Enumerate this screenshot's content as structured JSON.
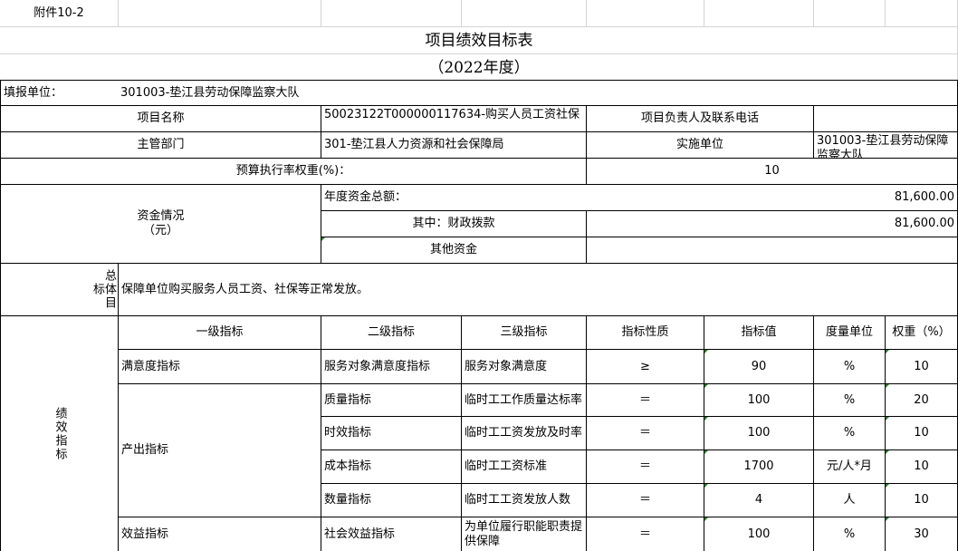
{
  "attachment": "附件10-2",
  "title": "项目绩效目标表",
  "year": "（2022年度）",
  "unit_label": "填报单位：",
  "unit_value": "301003-垫江县劳动保障监察大队",
  "project_name_label": "项目名称",
  "project_name_value": "50023122T000000117634-购买人员工资社保",
  "contact_label": "项目负责人及联系电话",
  "contact_value": "",
  "dept_label": "主管部门",
  "dept_value": "301-垫江县人力资源和社会保障局",
  "impl_label": "实施单位",
  "impl_value": "301003-垫江县劳动保障监察大队",
  "budget_weight_label": "预算执行率权重(%)：",
  "budget_weight_value": "10",
  "funds_label": "资金情况\n（元）",
  "funds_total_label": "年度资金总额：",
  "funds_total_value": "81,600.00",
  "funds_fiscal_label": "其中：财政拨款",
  "funds_fiscal_value": "81,600.00",
  "funds_other_label": "其他资金",
  "funds_other_value": "",
  "goal_label": "总体目标",
  "goal_value": "保障单位购买服务人员工资、社保等正常发放。",
  "perf_label": "绩效指标",
  "headers": [
    "一级指标",
    "二级指标",
    "三级指标",
    "指标性质",
    "指标值",
    "度量单位",
    "权重（%）"
  ],
  "level1": [
    "满意度指标",
    "产出指标",
    "效益指标"
  ],
  "rows": [
    {
      "l2": "服务对象满意度指标",
      "l3": "服务对象满意度",
      "nature": "≥",
      "value": "90",
      "unit": "%",
      "weight": "10"
    },
    {
      "l2": "质量指标",
      "l3": "临时工工作质量达标率",
      "nature": "＝",
      "value": "100",
      "unit": "%",
      "weight": "20"
    },
    {
      "l2": "时效指标",
      "l3": "临时工工资发放及时率",
      "nature": "＝",
      "value": "100",
      "unit": "%",
      "weight": "10"
    },
    {
      "l2": "成本指标",
      "l3": "临时工工资标准",
      "nature": "＝",
      "value": "1700",
      "unit": "元/人*月",
      "weight": "10"
    },
    {
      "l2": "数量指标",
      "l3": "临时工工资发放人数",
      "nature": "＝",
      "value": "4",
      "unit": "人",
      "weight": "10"
    },
    {
      "l2": "社会效益指标",
      "l3": "为单位履行职能职责提供保障",
      "nature": "＝",
      "value": "100",
      "unit": "%",
      "weight": "30"
    }
  ]
}
